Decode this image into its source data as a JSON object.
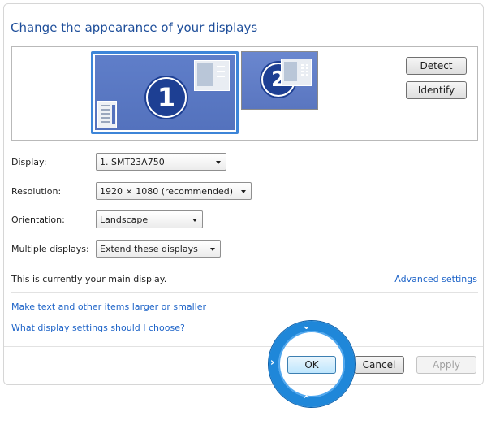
{
  "title": "Change the appearance of your displays",
  "monitors": [
    {
      "number": "1"
    },
    {
      "number": "2"
    }
  ],
  "buttons": {
    "detect": "Detect",
    "identify": "Identify",
    "ok": "OK",
    "cancel": "Cancel",
    "apply": "Apply"
  },
  "fields": {
    "display": {
      "label": "Display:",
      "value": "1. SMT23A750"
    },
    "resolution": {
      "label": "Resolution:",
      "value": "1920 × 1080 (recommended)"
    },
    "orientation": {
      "label": "Orientation:",
      "value": "Landscape"
    },
    "multiple": {
      "label": "Multiple displays:",
      "value": "Extend these displays"
    }
  },
  "status_text": "This is currently your main display.",
  "links": {
    "advanced": "Advanced settings",
    "larger_text": "Make text and other items larger or smaller",
    "which_settings": "What display settings should I choose?"
  },
  "colors": {
    "accent": "#1f87d9",
    "title": "#1e4e9a",
    "link": "#1e64c8",
    "monitor": "#5f7ec9",
    "selection": "#3d85d8"
  }
}
